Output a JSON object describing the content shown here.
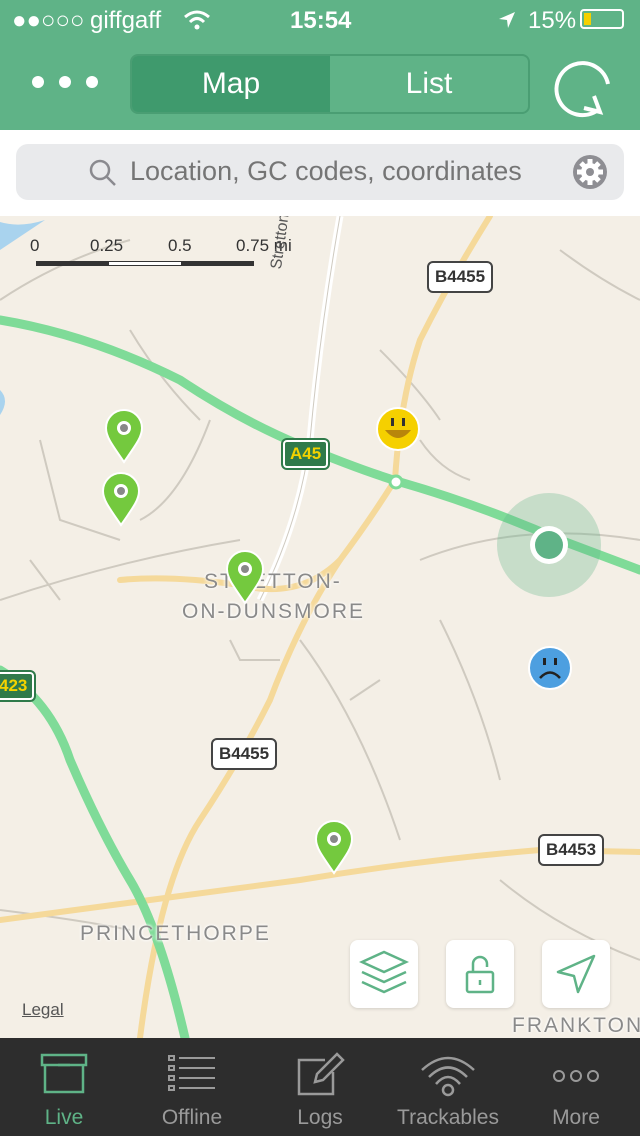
{
  "status": {
    "carrier": "giffgaff",
    "time": "15:54",
    "battery": "15%"
  },
  "header": {
    "tabs": [
      "Map",
      "List"
    ],
    "active_tab": "Map"
  },
  "search": {
    "placeholder": "Location, GC codes, coordinates"
  },
  "map": {
    "scale_labels": [
      "0",
      "0.25",
      "0.5",
      "0.75 mi"
    ],
    "road_labels": {
      "stretton_rd": "Stretton Rd",
      "b4455_top": "B4455",
      "a45": "A45",
      "a423": "423",
      "b4455_mid": "B4455",
      "b4453": "B4453"
    },
    "place_labels": {
      "stretton_1": "STRETTON-",
      "stretton_2": "ON-DUNSMORE",
      "princethorpe": "PRINCETHORPE",
      "frankton": "FRANKTON"
    },
    "legal": "Legal",
    "colors": {
      "road_major": "#7fdb98",
      "road_minor": "#f5d99a",
      "pin_green": "#74c93e",
      "user_dot": "#5fb387"
    }
  },
  "tabbar": {
    "items": [
      "Live",
      "Offline",
      "Logs",
      "Trackables",
      "More"
    ],
    "active": "Live"
  }
}
